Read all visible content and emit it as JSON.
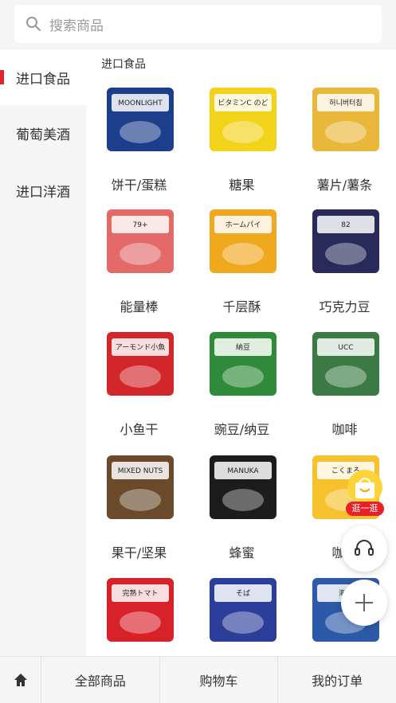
{
  "search": {
    "placeholder": "搜索商品"
  },
  "sidebar": {
    "items": [
      {
        "label": "进口食品",
        "active": true
      },
      {
        "label": "葡萄美酒",
        "active": false
      },
      {
        "label": "进口洋酒",
        "active": false
      }
    ]
  },
  "main": {
    "section_title": "进口食品",
    "products": [
      {
        "label": "饼干/蛋糕",
        "icon": "biscuit-box",
        "img_text": "MOONLIGHT",
        "color": "#1d3e8c"
      },
      {
        "label": "糖果",
        "icon": "candy-bag",
        "img_text": "ビタミンC のど飴",
        "color": "#f3d21a"
      },
      {
        "label": "薯片/薯条",
        "icon": "chips-bag",
        "img_text": "허니버터칩",
        "color": "#e9b73a"
      },
      {
        "label": "能量棒",
        "icon": "energy-bar-box",
        "img_text": "79+",
        "color": "#e46a6a"
      },
      {
        "label": "千层酥",
        "icon": "pastry-pack",
        "img_text": "ホームパイ",
        "color": "#f0a81e"
      },
      {
        "label": "巧克力豆",
        "icon": "chocolate-jar",
        "img_text": "82",
        "color": "#2a2a5a"
      },
      {
        "label": "小鱼干",
        "icon": "dried-fish-bag",
        "img_text": "アーモンド小魚",
        "color": "#d2262b"
      },
      {
        "label": "豌豆/纳豆",
        "icon": "natto-bag",
        "img_text": "納豆",
        "color": "#2f8a3a"
      },
      {
        "label": "咖啡",
        "icon": "coffee-box",
        "img_text": "UCC",
        "color": "#3b7a44"
      },
      {
        "label": "果干/坚果",
        "icon": "nuts-jar",
        "img_text": "MIXED NUTS",
        "color": "#6b4a2b"
      },
      {
        "label": "蜂蜜",
        "icon": "honey-jar",
        "img_text": "MANUKA HONEY",
        "color": "#1c1c1c"
      },
      {
        "label": "咖喱",
        "icon": "curry-box",
        "img_text": "こくまろ",
        "color": "#f6c12d"
      },
      {
        "label": "",
        "icon": "sauce-box",
        "img_text": "完熟トマト",
        "color": "#d8222a"
      },
      {
        "label": "",
        "icon": "noodle-bag",
        "img_text": "そば",
        "color": "#2b3f9a"
      },
      {
        "label": "",
        "icon": "cream-stew-box",
        "img_text": "海道",
        "color": "#2c5aa8"
      }
    ]
  },
  "floating": {
    "promo_label": "逛一逛",
    "service_icon": "headset-icon",
    "add_icon": "plus-icon"
  },
  "tabbar": {
    "home_icon": "home-icon",
    "tabs": [
      {
        "label": "全部商品"
      },
      {
        "label": "购物车"
      },
      {
        "label": "我的订单"
      }
    ]
  }
}
